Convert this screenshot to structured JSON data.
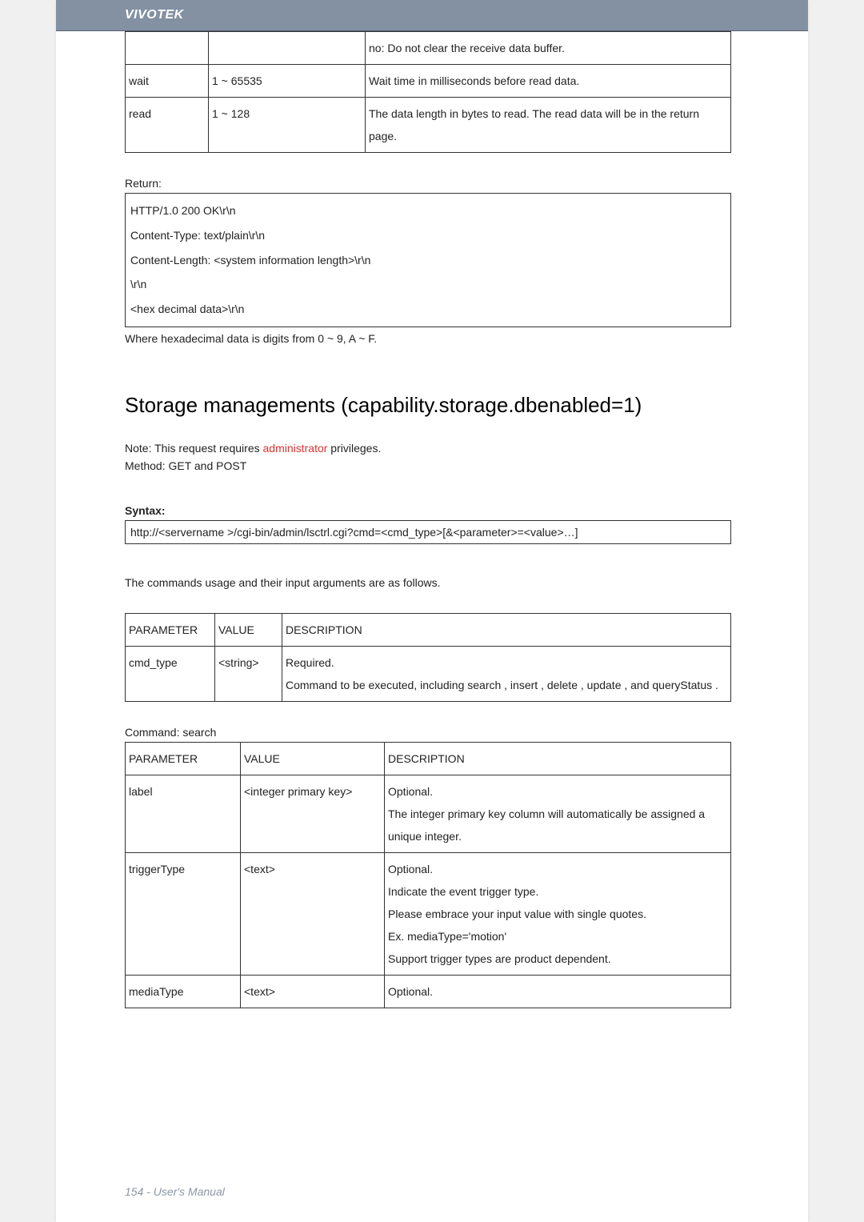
{
  "header": {
    "brand": "VIVOTEK"
  },
  "top_table": {
    "rows": [
      {
        "p": "",
        "v": "",
        "d": "no: Do not clear the receive data buffer."
      },
      {
        "p": "wait",
        "v": "1 ~ 65535",
        "d": "Wait time in milliseconds before read data."
      },
      {
        "p": "read",
        "v": "1 ~ 128",
        "d": "The data length in bytes to read. The read data will be in the return page."
      }
    ]
  },
  "return_label": "Return:",
  "return_box": [
    "HTTP/1.0 200 OK\\r\\n",
    "Content-Type: text/plain\\r\\n",
    "Content-Length: <system information length>\\r\\n",
    "\\r\\n",
    "<hex decimal data>\\r\\n"
  ],
  "hex_note": "Where hexadecimal data is digits from 0 ~ 9, A ~ F.",
  "section_title": "Storage managements (capability.storage.dbenabled=1)",
  "note_prefix": "Note:   This request requires ",
  "note_admin": "administrator",
  "note_suffix": " privileges.",
  "method_line": "Method:   GET and POST",
  "syntax_label": "Syntax:",
  "syntax_box": "http://<servername >/cgi-bin/admin/lsctrl.cgi?cmd=<cmd_type>[&<parameter>=<value>…]",
  "usage_line": "The commands usage and their input arguments are as follows.",
  "cmd_table": {
    "headers": [
      "PARAMETER",
      "VALUE",
      "DESCRIPTION"
    ],
    "rows": [
      {
        "p": "cmd_type",
        "v": "<string>",
        "d": "Required.\nCommand to be executed, including search , insert , delete , update , and queryStatus  ."
      }
    ]
  },
  "cmd_search_label": "Command: search",
  "search_table": {
    "headers": [
      "PARAMETER",
      "VALUE",
      "DESCRIPTION"
    ],
    "rows": [
      {
        "p": "label",
        "v": "<integer primary key>",
        "d": "Optional.\nThe integer primary key column will automatically be assigned a unique integer."
      },
      {
        "p": "triggerType",
        "v": "<text>",
        "d": "Optional.\nIndicate the event trigger type.\nPlease embrace your input value with single quotes.\nEx. mediaType='motion'\nSupport trigger types are product dependent."
      },
      {
        "p": "mediaType",
        "v": "<text>",
        "d": "Optional."
      }
    ]
  },
  "footer": "154 - User's Manual"
}
